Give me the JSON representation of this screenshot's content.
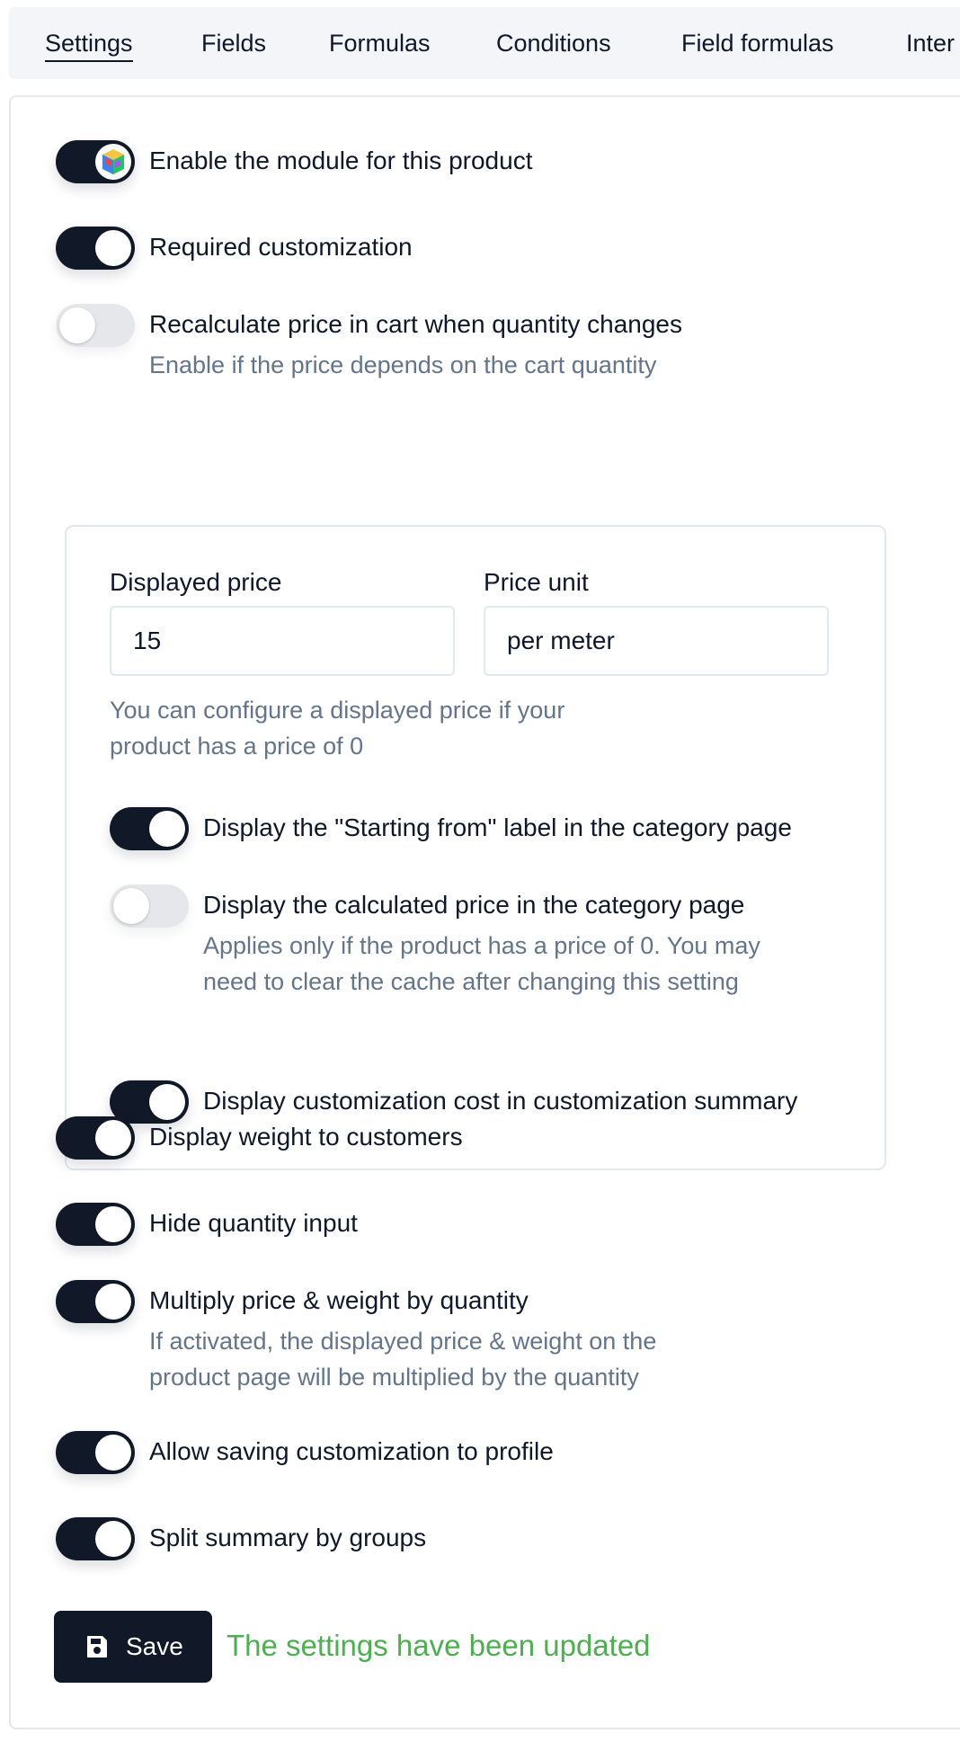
{
  "tabs": [
    {
      "label": "Settings",
      "active": true
    },
    {
      "label": "Fields"
    },
    {
      "label": "Formulas"
    },
    {
      "label": "Conditions"
    },
    {
      "label": "Field formulas"
    },
    {
      "label": "Inter"
    }
  ],
  "settings": {
    "enable_module": {
      "label": "Enable the module for this product",
      "on": true
    },
    "required_customization": {
      "label": "Required customization",
      "on": true
    },
    "recalculate_price": {
      "label": "Recalculate price in cart when quantity changes",
      "help": "Enable if the price depends on the cart quantity",
      "on": false
    },
    "displayed_price": {
      "label": "Displayed price",
      "value": "15"
    },
    "price_unit": {
      "label": "Price unit",
      "value": "per meter"
    },
    "price_help": "You can configure a displayed price if your product has a price of 0",
    "starting_from": {
      "label": "Display the \"Starting from\" label in the category page",
      "on": true
    },
    "calculated_price": {
      "label": "Display the calculated price in the category page",
      "help": "Applies only if the product has a price of 0. You may need to clear the cache after changing this setting",
      "on": false
    },
    "customization_cost": {
      "label": "Display customization cost in customization summary",
      "on": true
    },
    "display_weight": {
      "label": "Display weight to customers",
      "on": true
    },
    "hide_quantity": {
      "label": "Hide quantity input",
      "on": true
    },
    "multiply_price": {
      "label": "Multiply price & weight by quantity",
      "help": "If activated, the displayed price & weight on the product page will be multiplied by the quantity",
      "on": true
    },
    "allow_saving": {
      "label": "Allow saving customization to profile",
      "on": true
    },
    "split_summary": {
      "label": "Split summary by groups",
      "on": true
    }
  },
  "save": {
    "label": "Save",
    "status": "The settings have been updated"
  },
  "colors": {
    "accent": "#111827",
    "success": "#4caf50",
    "muted": "#64748b"
  }
}
